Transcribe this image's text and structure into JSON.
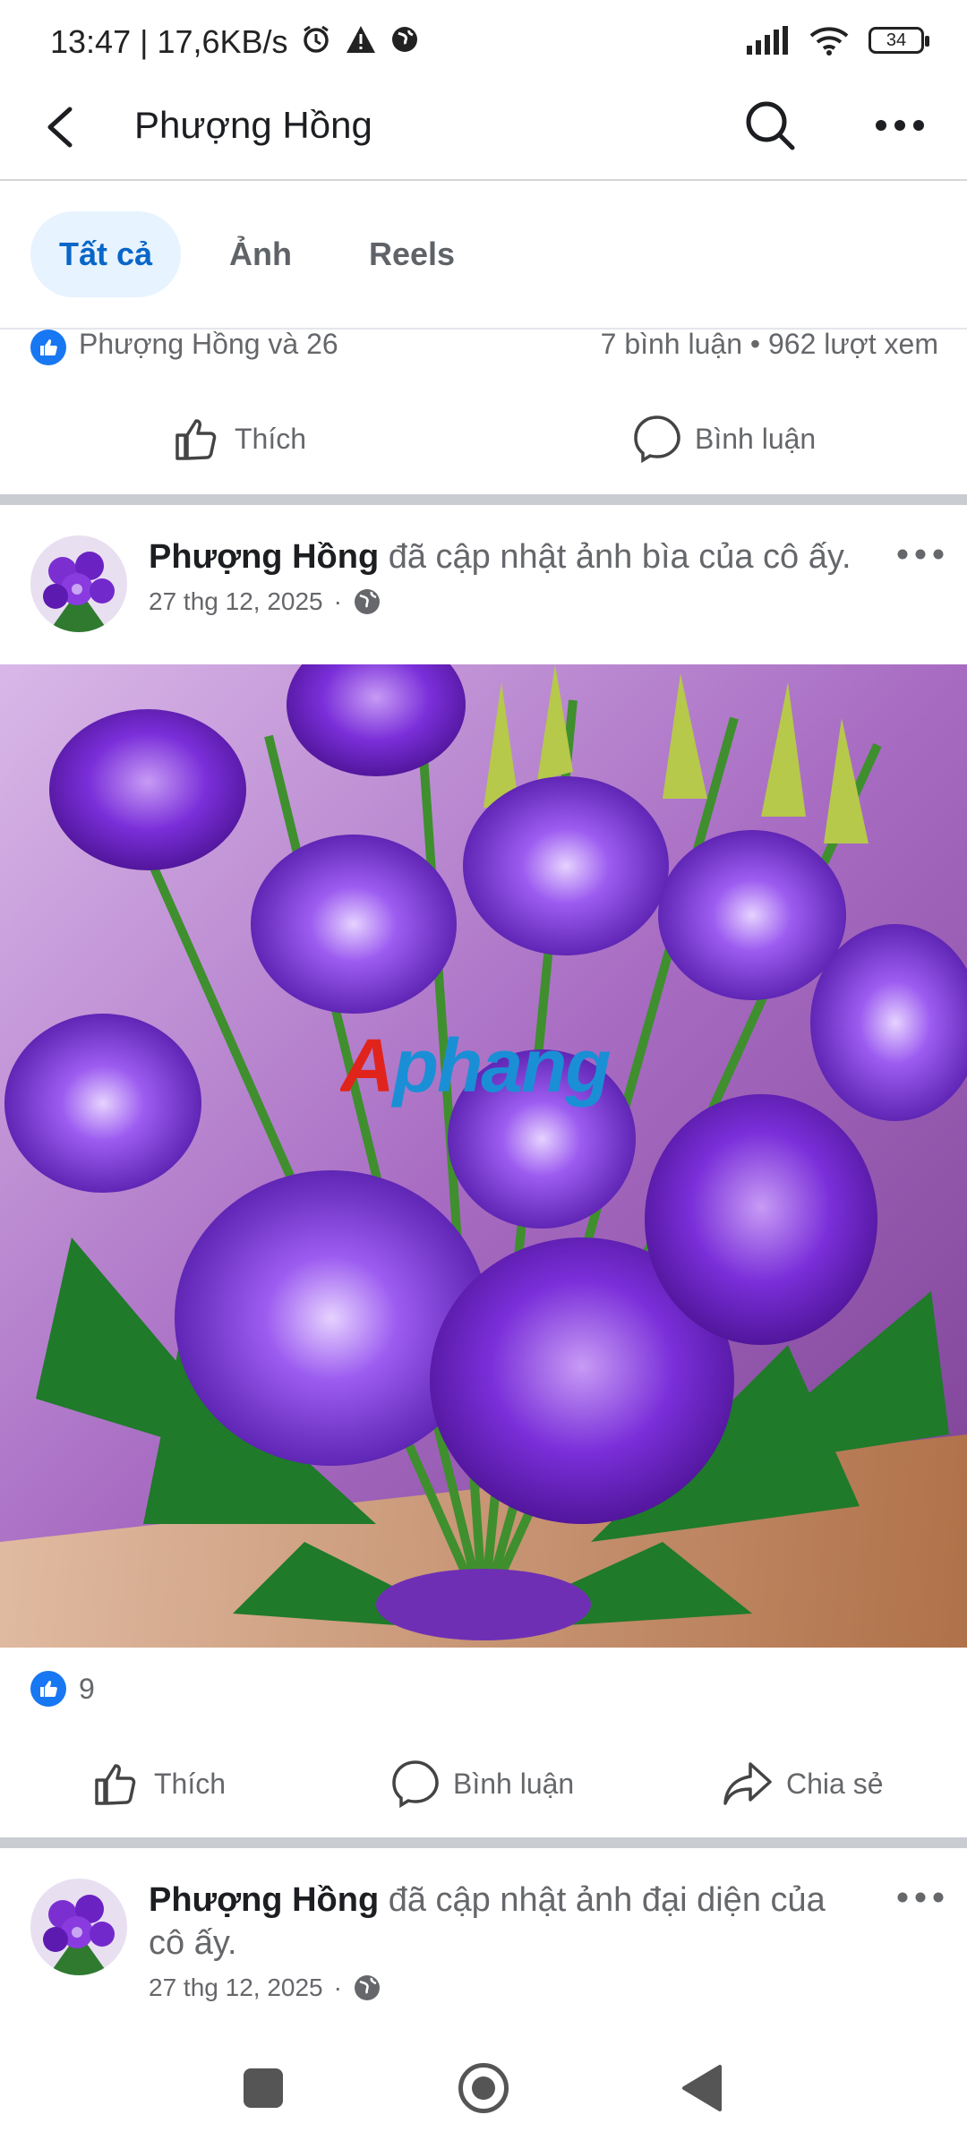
{
  "status_bar": {
    "time": "13:47 | 17,6KB/s",
    "battery": "34"
  },
  "header": {
    "title": "Phượng Hồng"
  },
  "tabs": [
    {
      "label": "Tất cả",
      "active": true
    },
    {
      "label": "Ảnh",
      "active": false
    },
    {
      "label": "Reels",
      "active": false
    }
  ],
  "prev_post": {
    "reactions_text": "Phượng Hồng và 26",
    "stats_text": "7 bình luận • 962 lượt xem",
    "like_label": "Thích",
    "comment_label": "Bình luận"
  },
  "post1": {
    "author": "Phượng Hồng",
    "action": " đã cập nhật ảnh bìa của cô ấy.",
    "date": "27 thg 12, 2025",
    "image_watermark": "Aphang",
    "like_count": "9",
    "like_label": "Thích",
    "comment_label": "Bình luận",
    "share_label": "Chia sẻ"
  },
  "post2": {
    "author": "Phượng Hồng",
    "action": " đã cập nhật ảnh đại diện của cô ấy.",
    "date": "27 thg 12, 2025"
  },
  "colors": {
    "accent": "#1877f2",
    "tab_active_bg": "#e7f3ff",
    "tab_active_text": "#0866c8"
  }
}
